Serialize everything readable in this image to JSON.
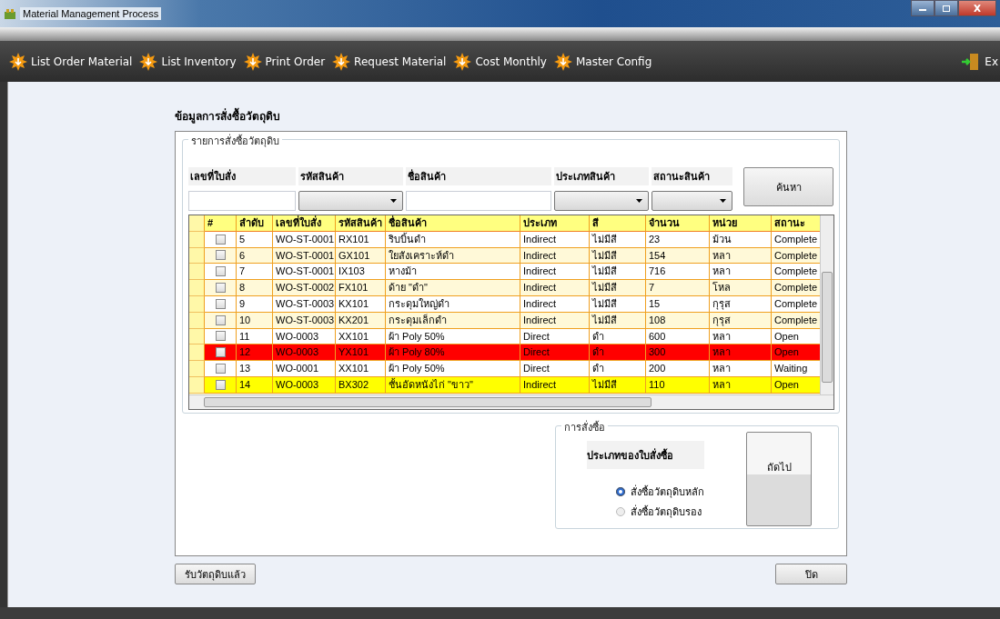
{
  "window": {
    "title": "Material Management Process"
  },
  "toolbar": {
    "items": [
      {
        "label": "List Order Material"
      },
      {
        "label": "List Inventory"
      },
      {
        "label": "Print Order"
      },
      {
        "label": "Request Material"
      },
      {
        "label": "Cost Monthly"
      },
      {
        "label": "Master Config"
      }
    ],
    "exit_label": "Ex"
  },
  "heading": "ข้อมูลการสั่งซื้อวัตถุดิบ",
  "order_list": {
    "title": "รายการสั่งซื้อวัตถุดิบ",
    "filters": [
      {
        "label": "เลขที่ใบสั่ง",
        "kind": "text"
      },
      {
        "label": "รหัสสินค้า",
        "kind": "dropdown"
      },
      {
        "label": "ชื่อสินค้า",
        "kind": "text"
      },
      {
        "label": "ประเภทสินค้า",
        "kind": "dropdown"
      },
      {
        "label": "สถานะสินค้า",
        "kind": "dropdown"
      }
    ],
    "search_button": "ค้นหา",
    "table": {
      "checkbox_header": "#",
      "columns": [
        "ลำดับ",
        "เลขที่ใบสั่ง",
        "รหัสสินค้า",
        "ชื่อสินค้า",
        "ประเภท",
        "สี",
        "จำนวน",
        "หน่วย",
        "สถานะ"
      ],
      "rows": [
        {
          "checked": false,
          "kind": "normal",
          "cells": [
            "5",
            "WO-ST-0001",
            "RX101",
            "ริบบิ้นดำ",
            "Indirect",
            "ไม่มีสี",
            "23",
            "ม้วน",
            "Complete"
          ]
        },
        {
          "checked": false,
          "kind": "normal",
          "cells": [
            "6",
            "WO-ST-0001",
            "GX101",
            "ใยสังเคราะห์ดำ",
            "Indirect",
            "ไม่มีสี",
            "154",
            "หลา",
            "Complete"
          ]
        },
        {
          "checked": false,
          "kind": "normal",
          "cells": [
            "7",
            "WO-ST-0001",
            "IX103",
            "หางม้า",
            "Indirect",
            "ไม่มีสี",
            "716",
            "หลา",
            "Complete"
          ]
        },
        {
          "checked": false,
          "kind": "normal",
          "cells": [
            "8",
            "WO-ST-0002",
            "FX101",
            "ด้าย \"ดำ\"",
            "Indirect",
            "ไม่มีสี",
            "7",
            "โหล",
            "Complete"
          ]
        },
        {
          "checked": false,
          "kind": "normal",
          "cells": [
            "9",
            "WO-ST-0003",
            "KX101",
            "กระดุมใหญ่ดำ",
            "Indirect",
            "ไม่มีสี",
            "15",
            "กุรุส",
            "Complete"
          ]
        },
        {
          "checked": false,
          "kind": "normal",
          "cells": [
            "10",
            "WO-ST-0003",
            "KX201",
            "กระดุมเล็กดำ",
            "Indirect",
            "ไม่มีสี",
            "108",
            "กุรุส",
            "Complete"
          ]
        },
        {
          "checked": false,
          "kind": "normal",
          "cells": [
            "11",
            "WO-0003",
            "XX101",
            "ผ้า Poly 50%",
            "Direct",
            "ดำ",
            "600",
            "หลา",
            "Open"
          ]
        },
        {
          "checked": false,
          "kind": "alert",
          "cells": [
            "12",
            "WO-0003",
            "YX101",
            "ผ้า Poly 80%",
            "Direct",
            "ดำ",
            "300",
            "หลา",
            "Open"
          ]
        },
        {
          "checked": false,
          "kind": "normal",
          "cells": [
            "13",
            "WO-0001",
            "XX101",
            "ผ้า Poly 50%",
            "Direct",
            "ดำ",
            "200",
            "หลา",
            "Waiting"
          ]
        },
        {
          "checked": false,
          "kind": "warning",
          "cells": [
            "14",
            "WO-0003",
            "BX302",
            "ชั้นอัดหนังไก่ \"ขาว\"",
            "Indirect",
            "ไม่มีสี",
            "110",
            "หลา",
            "Open"
          ]
        }
      ]
    }
  },
  "order": {
    "title": "การสั่งซื้อ",
    "label": "ประเภทของใบสั่งซื้อ",
    "options": [
      {
        "label": "สั่งซื้อวัตถุดิบหลัก",
        "selected": true
      },
      {
        "label": "สั่งซื้อวัตถุดิบรอง",
        "selected": false
      }
    ],
    "next_button": "ถัดไป"
  },
  "receive_button": "รับวัตถุดิบแล้ว",
  "close_button": "ปิด"
}
